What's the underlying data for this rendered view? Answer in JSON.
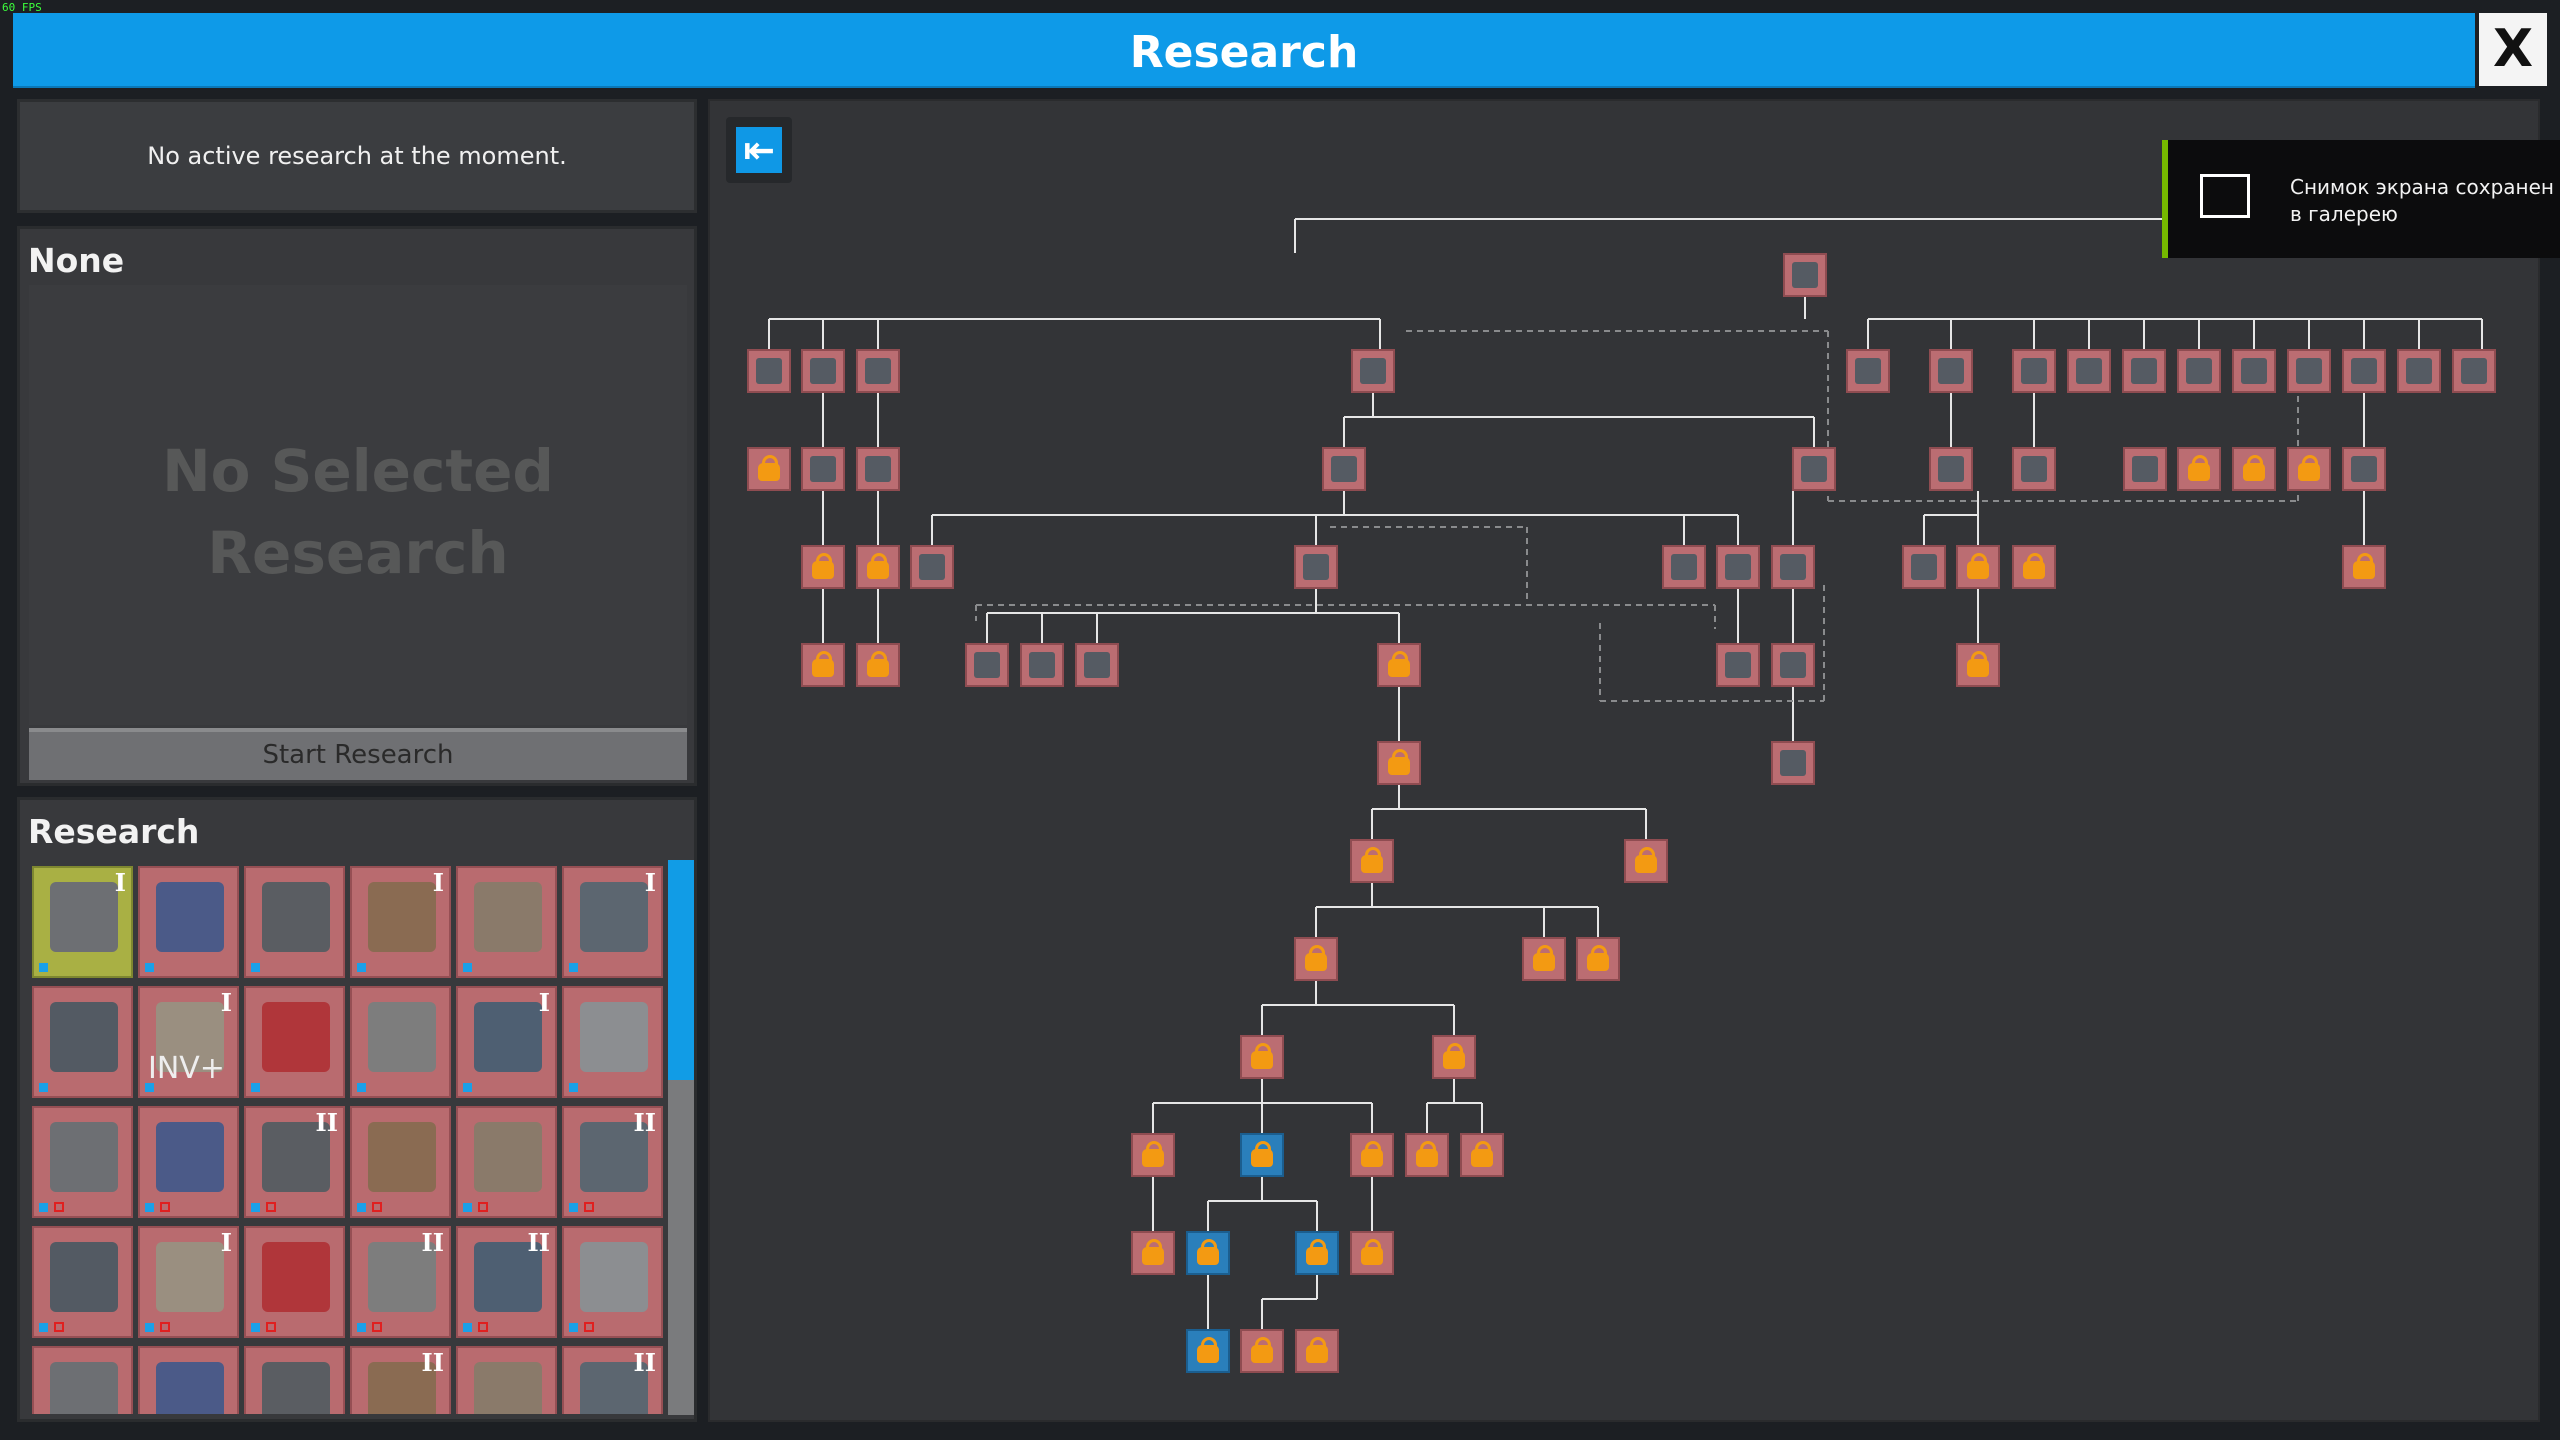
{
  "fps": "60 FPS",
  "window": {
    "title": "Research",
    "close_label": "X"
  },
  "status": {
    "text": "No active research at the moment."
  },
  "selected": {
    "heading": "None",
    "placeholder_line1": "No Selected",
    "placeholder_line2": "Research",
    "start_button": "Start Research"
  },
  "research_list": {
    "heading": "Research",
    "items": [
      {
        "level": "I",
        "icon": "autominer-icon",
        "state": "active"
      },
      {
        "level": "",
        "icon": "chest-icon"
      },
      {
        "level": "",
        "icon": "power-generator-icon"
      },
      {
        "level": "I",
        "icon": "robot-upgrade-icon"
      },
      {
        "level": "",
        "icon": "storage-crate-icon"
      },
      {
        "level": "I",
        "icon": "conveyor-block-icon"
      },
      {
        "level": "",
        "icon": "wall-block-icon"
      },
      {
        "level": "I",
        "icon": "inventory-upgrade-icon",
        "label": "INV+"
      },
      {
        "level": "",
        "icon": "gate-icon"
      },
      {
        "level": "",
        "icon": "lamp-post-icon"
      },
      {
        "level": "I",
        "icon": "conveyor-machine-icon"
      },
      {
        "level": "",
        "icon": "drill-icon"
      },
      {
        "level": "",
        "icon": "turret-icon"
      },
      {
        "level": "",
        "icon": "fence-icon"
      },
      {
        "level": "II",
        "icon": "smelter-icon"
      },
      {
        "level": "",
        "icon": "monitor-icon"
      },
      {
        "level": "",
        "icon": "stairs-icon"
      },
      {
        "level": "II",
        "icon": "autominer-icon"
      },
      {
        "level": "",
        "icon": "pipe-icon"
      },
      {
        "level": "I",
        "icon": "speed-upgrade-icon"
      },
      {
        "level": "",
        "icon": "ore-icon"
      },
      {
        "level": "II",
        "icon": "assembler-icon"
      },
      {
        "level": "II",
        "icon": "platform-icon"
      },
      {
        "level": "",
        "icon": "door-icon"
      },
      {
        "level": "",
        "icon": "tank-icon"
      },
      {
        "level": "",
        "icon": "pump-icon"
      },
      {
        "level": "",
        "icon": "machine-icon"
      },
      {
        "level": "II",
        "icon": "robot-icon"
      },
      {
        "level": "",
        "icon": "glass-icon"
      },
      {
        "level": "II",
        "icon": "chest-icon"
      }
    ]
  },
  "tree": {
    "back_icon": "back-arrow-icon"
  },
  "toast": {
    "line1": "Снимок экрана сохранен",
    "line2": "в галерею"
  }
}
